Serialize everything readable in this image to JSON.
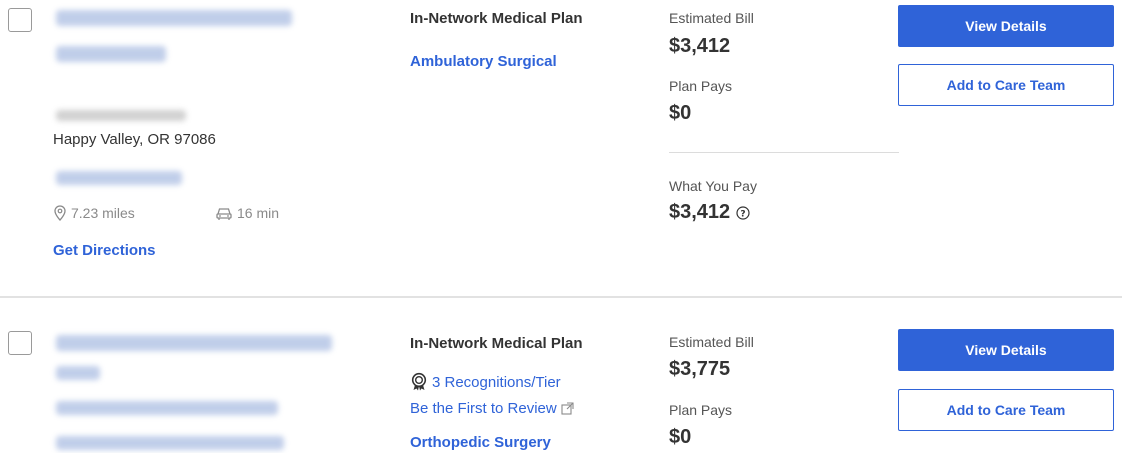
{
  "providers": [
    {
      "city_state_zip": "Happy Valley, OR 97086",
      "distance": "7.23 miles",
      "drive_time": "16 min",
      "directions_label": "Get Directions",
      "plan_title": "In-Network Medical Plan",
      "specialty": "Ambulatory Surgical",
      "estimated_bill_label": "Estimated Bill",
      "estimated_bill": "$3,412",
      "plan_pays_label": "Plan Pays",
      "plan_pays": "$0",
      "what_you_pay_label": "What You Pay",
      "what_you_pay": "$3,412",
      "view_details_label": "View Details",
      "add_care_team_label": "Add to Care Team"
    },
    {
      "plan_title": "In-Network Medical Plan",
      "recognitions": "3 Recognitions/Tier",
      "review_link": "Be the First to Review",
      "specialty": "Orthopedic Surgery",
      "estimated_bill_label": "Estimated Bill",
      "estimated_bill": "$3,775",
      "plan_pays_label": "Plan Pays",
      "plan_pays": "$0",
      "view_details_label": "View Details",
      "add_care_team_label": "Add to Care Team"
    }
  ],
  "colors": {
    "accent": "#2f63d8",
    "text": "#333333",
    "muted": "#8a8a8a"
  },
  "icons": [
    "location-pin-icon",
    "car-icon",
    "help-circle-icon",
    "award-ribbon-icon",
    "external-link-icon"
  ]
}
